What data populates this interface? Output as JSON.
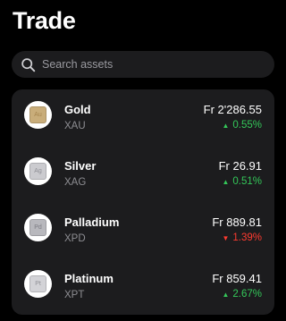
{
  "page": {
    "title": "Trade"
  },
  "search": {
    "placeholder": "Search assets",
    "icon": "search-icon"
  },
  "colors": {
    "positive": "#34c759",
    "negative": "#ff3b30",
    "card_bg": "#1c1c1e"
  },
  "assets": [
    {
      "name": "Gold",
      "code": "XAU",
      "symbol": "Au",
      "price": "Fr 2'286.55",
      "change": "0.55%",
      "direction": "up",
      "arrow": "▲",
      "coin_color": "#c9ad7a",
      "symbol_color": "#a6854f"
    },
    {
      "name": "Silver",
      "code": "XAG",
      "symbol": "Ag",
      "price": "Fr 26.91",
      "change": "0.51%",
      "direction": "up",
      "arrow": "▲",
      "coin_color": "#cbcbcf",
      "symbol_color": "#8f8f95"
    },
    {
      "name": "Palladium",
      "code": "XPD",
      "symbol": "Pd",
      "price": "Fr 889.81",
      "change": "1.39%",
      "direction": "down",
      "arrow": "▼",
      "coin_color": "#b8b8bd",
      "symbol_color": "#7d7d83"
    },
    {
      "name": "Platinum",
      "code": "XPT",
      "symbol": "Pt",
      "price": "Fr 859.41",
      "change": "2.67%",
      "direction": "up",
      "arrow": "▲",
      "coin_color": "#d3d3d7",
      "symbol_color": "#919197"
    }
  ]
}
